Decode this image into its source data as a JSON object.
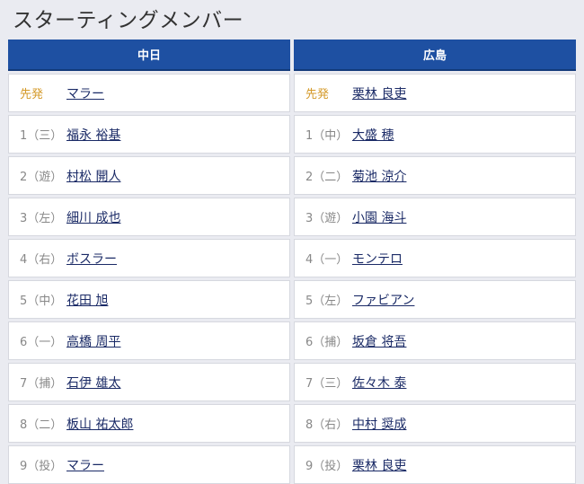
{
  "page": {
    "title": "スターティングメンバー"
  },
  "teams": [
    {
      "name": "中日",
      "rows": [
        {
          "order": "先発",
          "player": "マラー"
        },
        {
          "order": "1（三）",
          "player": "福永 裕基"
        },
        {
          "order": "2（遊）",
          "player": "村松 開人"
        },
        {
          "order": "3（左）",
          "player": "細川 成也"
        },
        {
          "order": "4（右）",
          "player": "ボスラー"
        },
        {
          "order": "5（中）",
          "player": "花田 旭"
        },
        {
          "order": "6（一）",
          "player": "高橋 周平"
        },
        {
          "order": "7（捕）",
          "player": "石伊 雄太"
        },
        {
          "order": "8（二）",
          "player": "板山 祐太郎"
        },
        {
          "order": "9（投）",
          "player": "マラー"
        }
      ]
    },
    {
      "name": "広島",
      "rows": [
        {
          "order": "先発",
          "player": "栗林 良吏"
        },
        {
          "order": "1（中）",
          "player": "大盛 穂"
        },
        {
          "order": "2（二）",
          "player": "菊池 涼介"
        },
        {
          "order": "3（遊）",
          "player": "小園 海斗"
        },
        {
          "order": "4（一）",
          "player": "モンテロ"
        },
        {
          "order": "5（左）",
          "player": "ファビアン"
        },
        {
          "order": "6（捕）",
          "player": "坂倉 将吾"
        },
        {
          "order": "7（三）",
          "player": "佐々木 泰"
        },
        {
          "order": "8（右）",
          "player": "中村 奨成"
        },
        {
          "order": "9（投）",
          "player": "栗林 良吏"
        }
      ]
    }
  ],
  "colors": {
    "header_bg": "#1e50a2",
    "starter_label": "#d49a2a",
    "player_link": "#1a2a66"
  }
}
